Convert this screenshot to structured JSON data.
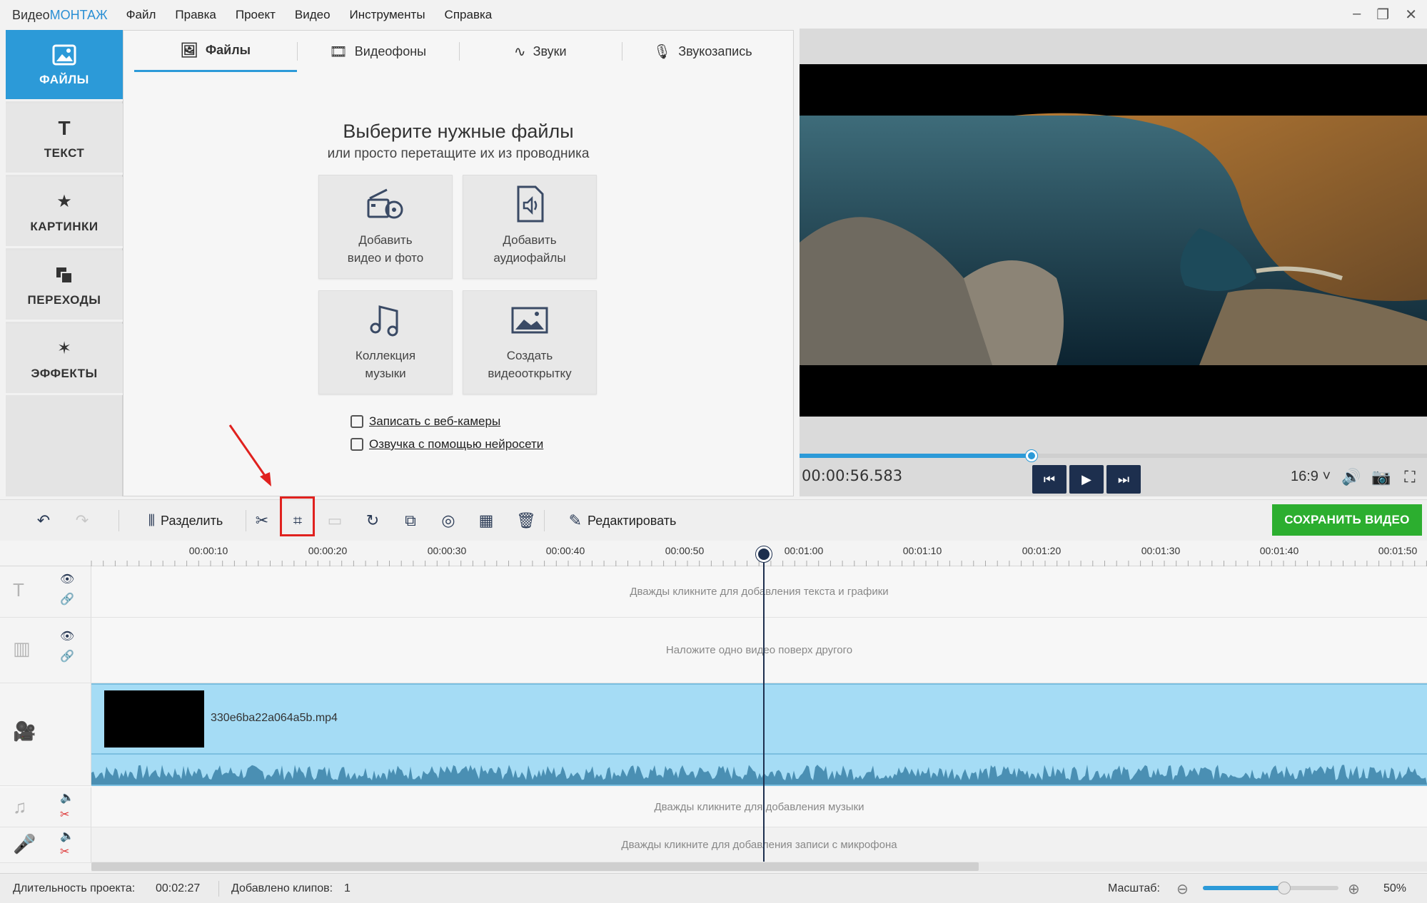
{
  "app": {
    "logo_prefix": "Видео",
    "logo_suffix": "МОНТАЖ",
    "menu": [
      "Файл",
      "Правка",
      "Проект",
      "Видео",
      "Инструменты",
      "Справка"
    ]
  },
  "sidebar": {
    "items": [
      {
        "label": "ФАЙЛЫ",
        "icon": "image-icon",
        "active": true
      },
      {
        "label": "ТЕКСТ",
        "icon": "text-icon"
      },
      {
        "label": "КАРТИНКИ",
        "icon": "star-icon"
      },
      {
        "label": "ПЕРЕХОДЫ",
        "icon": "transitions-icon"
      },
      {
        "label": "ЭФФЕКТЫ",
        "icon": "magic-wand-icon"
      }
    ]
  },
  "panel": {
    "tabs": [
      {
        "label": "Файлы",
        "icon": "image-icon",
        "active": true
      },
      {
        "label": "Видеофоны",
        "icon": "video-bg-icon"
      },
      {
        "label": "Звуки",
        "icon": "waveform-icon"
      },
      {
        "label": "Звукозапись",
        "icon": "microphone-icon"
      }
    ],
    "headline": "Выберите нужные файлы",
    "subline": "или просто перетащите их из проводника",
    "tiles": [
      {
        "label": "Добавить\nвидео и фото",
        "icon": "film-camera-icon"
      },
      {
        "label": "Добавить\nаудиофайлы",
        "icon": "audio-file-icon"
      },
      {
        "label": "Коллекция\nмузыки",
        "icon": "music-notes-icon"
      },
      {
        "label": "Создать\nвидеооткрытку",
        "icon": "postcard-icon"
      }
    ],
    "links": [
      {
        "label": "Записать с веб-камеры",
        "icon": "webcam-icon"
      },
      {
        "label": "Озвучка с помощью нейросети",
        "icon": "ai-voice-icon"
      }
    ]
  },
  "preview": {
    "timecode": "00:00:56.583",
    "progress": 0.37,
    "aspect": "16:9 ˅"
  },
  "toolbar": {
    "split_label": "Разделить",
    "edit_label": "Редактировать",
    "save_label": "СОХРАНИТЬ ВИДЕО"
  },
  "timeline": {
    "ticks": [
      "00:00:10",
      "00:00:20",
      "00:00:30",
      "00:00:40",
      "00:00:50",
      "00:01:00",
      "00:01:10",
      "00:01:20",
      "00:01:30",
      "00:01:40",
      "00:01:50"
    ],
    "text_track_hint": "Дважды кликните для добавления текста и графики",
    "overlay_track_hint": "Наложите одно видео поверх другого",
    "clip_name": "330e6ba22a064a5b.mp4",
    "music_track_hint": "Дважды кликните для добавления музыки",
    "mic_track_hint": "Дважды кликните для добавления записи с микрофона"
  },
  "status": {
    "duration_label": "Длительность проекта:",
    "duration_value": "00:02:27",
    "clips_label": "Добавлено клипов:",
    "clips_value": "1",
    "zoom_label": "Масштаб:",
    "zoom_value": "50%",
    "zoom_level": 0.6
  },
  "colors": {
    "accent": "#2c9ad8",
    "dark_button": "#1d2f4e",
    "save_green": "#2cae2f",
    "highlight_red": "#e0211e"
  }
}
